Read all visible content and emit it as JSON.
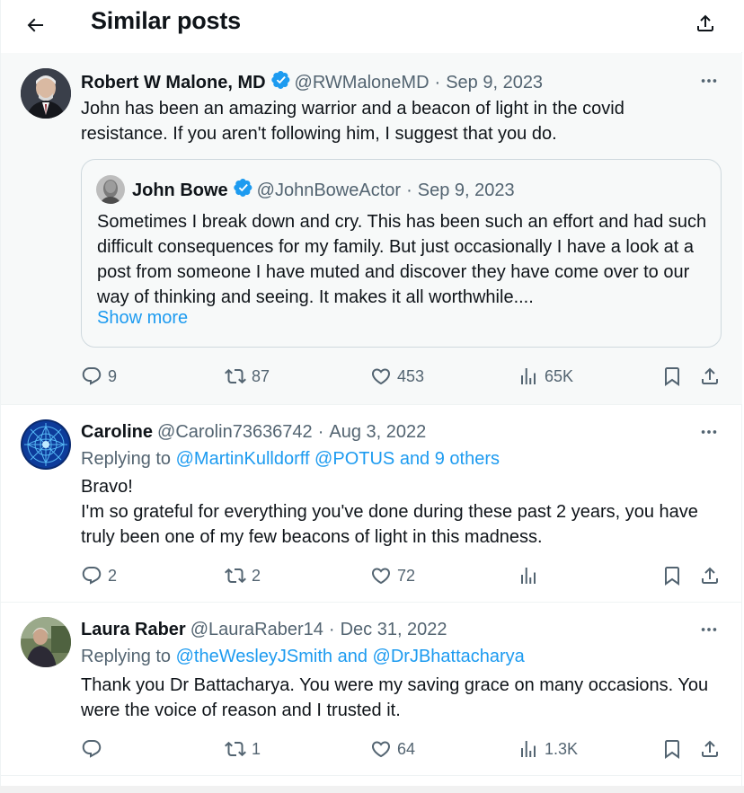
{
  "header": {
    "title": "Similar posts",
    "back_icon": "arrow-left-icon",
    "share_icon": "share-icon"
  },
  "colors": {
    "link": "#1d9bf0",
    "muted": "#536471",
    "verified": "#1d9bf0",
    "highlight_bg": "#f7f9f9"
  },
  "posts": [
    {
      "name": "Robert W Malone, MD",
      "handle": "@RWMaloneMD",
      "sep": "·",
      "date": "Sep 9, 2023",
      "verified": true,
      "text": "John has been an amazing warrior and a beacon of light in the covid resistance.  If you aren't following him, I suggest that you do.",
      "quote": {
        "name": "John Bowe",
        "handle": "@JohnBoweActor",
        "sep": "·",
        "date": "Sep 9, 2023",
        "text": "Sometimes I break down and cry. This has been such an effort and had such difficult consequences for my family. But just occasionally I have a look at a post from someone I have muted and discover they have come over to our way of thinking and seeing. It makes it all worthwhile....",
        "show_more": "Show more"
      },
      "stats": {
        "replies": "9",
        "reposts": "87",
        "likes": "453",
        "views": "65K"
      }
    },
    {
      "name": "Caroline",
      "handle": "@Carolin73636742",
      "sep": "·",
      "date": "Aug 3, 2022",
      "replying_prefix": "Replying to ",
      "replying_to": "@MartinKulldorff @POTUS and 9 others",
      "text": "Bravo!\nI'm so grateful for everything you've done during these past 2 years, you have truly been one of my few beacons of light in this madness.",
      "stats": {
        "replies": "2",
        "reposts": "2",
        "likes": "72",
        "views": ""
      }
    },
    {
      "name": "Laura Raber",
      "handle": "@LauraRaber14",
      "sep": "·",
      "date": "Dec 31, 2022",
      "replying_prefix": "Replying to ",
      "replying_to": "@theWesleyJSmith and @DrJBhattacharya",
      "text": "Thank you Dr Battacharya. You were my saving grace on many occasions. You were the voice of reason and I trusted it.",
      "stats": {
        "replies": "",
        "reposts": "1",
        "likes": "64",
        "views": "1.3K"
      }
    }
  ]
}
